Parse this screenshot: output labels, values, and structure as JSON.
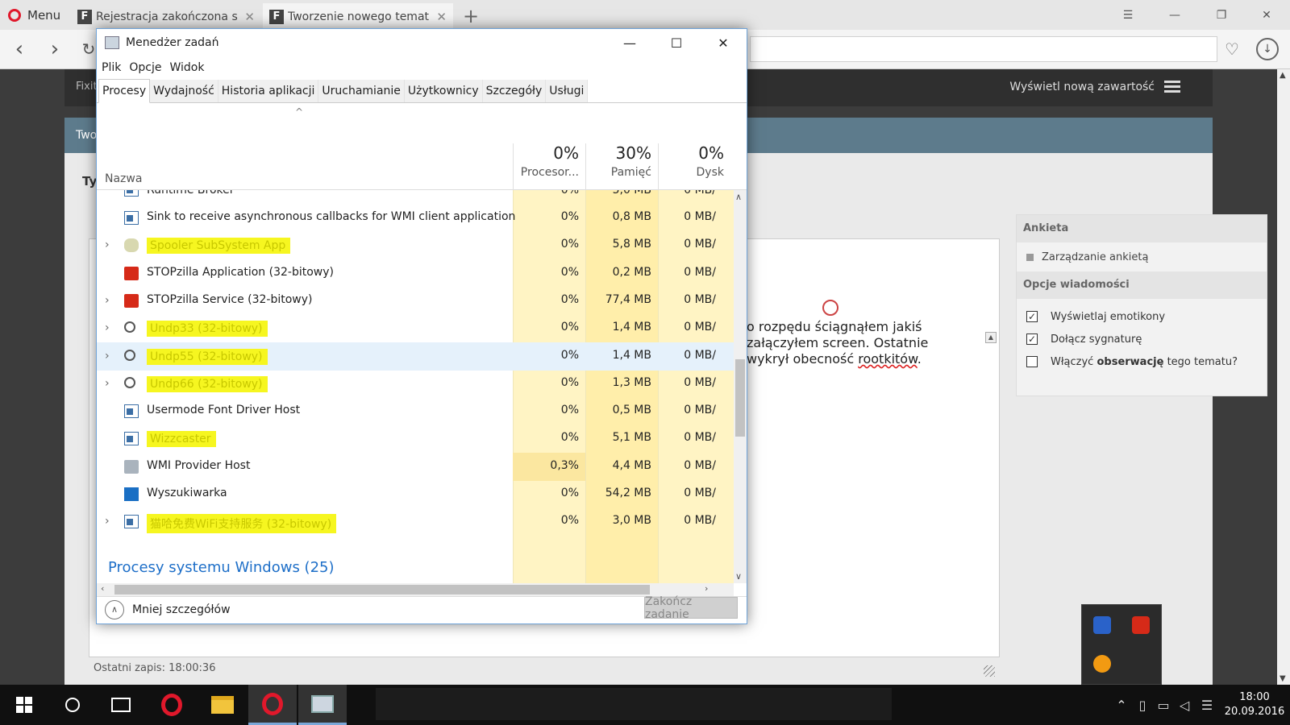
{
  "browser": {
    "menu_label": "Menu",
    "tabs": [
      {
        "title": "Rejestracja zakończona suk",
        "favicon": "F"
      },
      {
        "title": "Tworzenie nowego tematu",
        "favicon": "F"
      }
    ],
    "new_tab": "+"
  },
  "forum": {
    "nav_left": "Fixit",
    "nav_right": "Wyświetl nową zawartość",
    "panel_title": "Twor",
    "type_label": "Ty",
    "editor_text": [
      "o rozpędu ściągnąłem jakiś",
      "załączyłem screen. Ostatnie",
      "wykrył obecność "
    ],
    "editor_misspelled": "rootkitów",
    "editor_tail": ".",
    "last_save": "Ostatni zapis: 18:00:36",
    "sidebar": {
      "poll_head": "Ankieta",
      "poll_item": "Zarządzanie ankietą",
      "options_head": "Opcje wiadomości",
      "options": [
        {
          "label": "Wyświetlaj emotikony",
          "checked": true
        },
        {
          "label": "Dołącz sygnaturę",
          "checked": true
        },
        {
          "label_pre": "Włączyć ",
          "label_bold": "obserwację",
          "label_post": " tego tematu?",
          "checked": false
        }
      ]
    }
  },
  "taskmanager": {
    "title": "Menedżer zadań",
    "menu": [
      "Plik",
      "Opcje",
      "Widok"
    ],
    "tabs": [
      "Procesy",
      "Wydajność",
      "Historia aplikacji",
      "Uruchamianie",
      "Użytkownicy",
      "Szczegóły",
      "Usługi"
    ],
    "active_tab": "Procesy",
    "columns": {
      "name": "Nazwa",
      "cpu": {
        "pct": "0%",
        "label": "Procesor..."
      },
      "mem": {
        "pct": "30%",
        "label": "Pamięć"
      },
      "disk": {
        "pct": "0%",
        "label": "Dysk"
      }
    },
    "cut_row": {
      "name": "Runtime Broker",
      "cpu": "0%",
      "mem": "5,0 MB",
      "disk": "0 MB/"
    },
    "rows": [
      {
        "name": "Sink to receive asynchronous callbacks for WMI client application",
        "cpu": "0%",
        "mem": "0,8 MB",
        "disk": "0 MB/",
        "expand": false,
        "icon": "window-icon",
        "highlighted": false
      },
      {
        "name": "Spooler SubSystem App",
        "cpu": "0%",
        "mem": "5,8 MB",
        "disk": "0 MB/",
        "expand": true,
        "icon": "printer-icon",
        "highlighted": true
      },
      {
        "name": "STOPzilla Application (32-bitowy)",
        "cpu": "0%",
        "mem": "0,2 MB",
        "disk": "0 MB/",
        "expand": false,
        "icon": "stopzilla-icon",
        "highlighted": false
      },
      {
        "name": "STOPzilla Service (32-bitowy)",
        "cpu": "0%",
        "mem": "77,4 MB",
        "disk": "0 MB/",
        "expand": true,
        "icon": "stopzilla-icon",
        "highlighted": false
      },
      {
        "name": "Undp33 (32-bitowy)",
        "cpu": "0%",
        "mem": "1,4 MB",
        "disk": "0 MB/",
        "expand": true,
        "icon": "magnifier-icon",
        "highlighted": true
      },
      {
        "name": "Undp55 (32-bitowy)",
        "cpu": "0%",
        "mem": "1,4 MB",
        "disk": "0 MB/",
        "expand": true,
        "icon": "magnifier-icon",
        "highlighted": true
      },
      {
        "name": "Undp66 (32-bitowy)",
        "cpu": "0%",
        "mem": "1,3 MB",
        "disk": "0 MB/",
        "expand": true,
        "icon": "magnifier-icon",
        "highlighted": true
      },
      {
        "name": "Usermode Font Driver Host",
        "cpu": "0%",
        "mem": "0,5 MB",
        "disk": "0 MB/",
        "expand": false,
        "icon": "window-icon",
        "highlighted": false
      },
      {
        "name": "Wizzcaster",
        "cpu": "0%",
        "mem": "5,1 MB",
        "disk": "0 MB/",
        "expand": false,
        "icon": "window-icon",
        "highlighted": true
      },
      {
        "name": "WMI Provider Host",
        "cpu": "0,3%",
        "mem": "4,4 MB",
        "disk": "0 MB/",
        "expand": false,
        "icon": "wmi-icon",
        "highlighted": false
      },
      {
        "name": "Wyszukiwarka",
        "cpu": "0%",
        "mem": "54,2 MB",
        "disk": "0 MB/",
        "expand": false,
        "icon": "search-app-icon",
        "highlighted": false
      },
      {
        "name": "猫哈免费WiFi支持服务 (32-bitowy)",
        "cpu": "0%",
        "mem": "3,0 MB",
        "disk": "0 MB/",
        "expand": true,
        "icon": "window-icon",
        "highlighted": true
      }
    ],
    "hover_row": 5,
    "group_header": "Procesy systemu Windows (25)",
    "less_details": "Mniej szczegółów",
    "end_task": "Zakończ zadanie"
  },
  "taskbar": {
    "time": "18:00",
    "date": "20.09.2016"
  },
  "colors": {
    "highlight_yellow": "#f6f620",
    "column_yellow": "#fff4c4",
    "link_blue": "#1e6fc8",
    "opera_red": "#e0182b"
  }
}
